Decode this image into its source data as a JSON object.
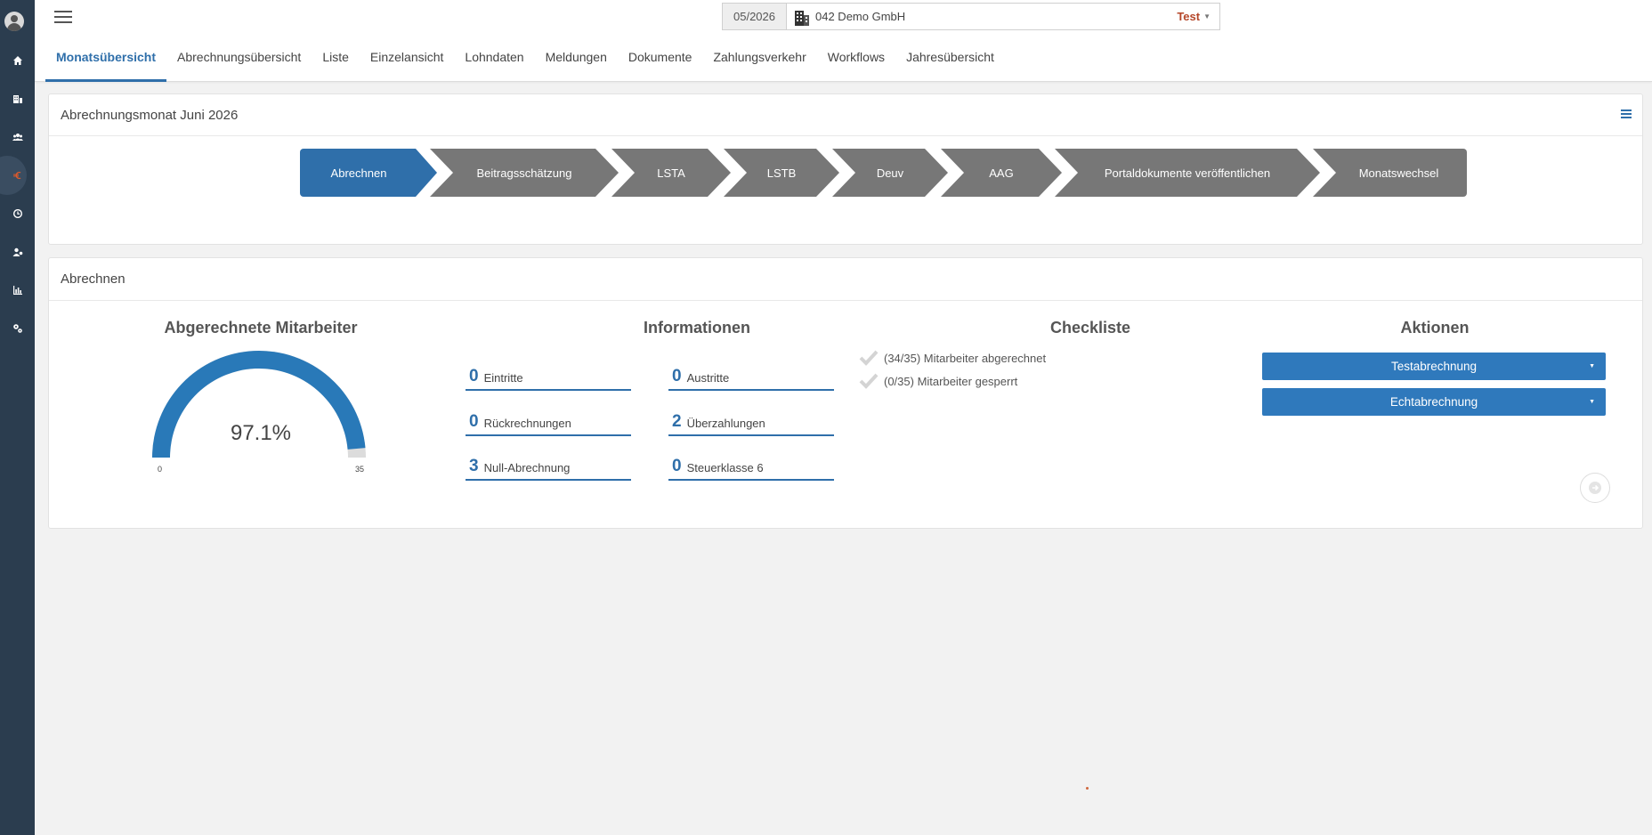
{
  "header": {
    "month": "05/2026",
    "company": "042 Demo GmbH",
    "environment": "Test"
  },
  "tabs": [
    {
      "label": "Monatsübersicht",
      "active": true
    },
    {
      "label": "Abrechnungsübersicht"
    },
    {
      "label": "Liste"
    },
    {
      "label": "Einzelansicht"
    },
    {
      "label": "Lohndaten"
    },
    {
      "label": "Meldungen"
    },
    {
      "label": "Dokumente"
    },
    {
      "label": "Zahlungsverkehr"
    },
    {
      "label": "Workflows"
    },
    {
      "label": "Jahresübersicht"
    }
  ],
  "sidebar": {
    "items": [
      {
        "icon": "home-icon"
      },
      {
        "icon": "building-icon"
      },
      {
        "icon": "users-icon"
      },
      {
        "icon": "euro-icon",
        "active": true
      },
      {
        "icon": "clock-icon"
      },
      {
        "icon": "user-settings-icon"
      },
      {
        "icon": "chart-icon"
      },
      {
        "icon": "cogs-icon"
      }
    ]
  },
  "process_panel": {
    "title": "Abrechnungsmonat Juni 2026",
    "steps": [
      {
        "label": "Abrechnen",
        "current": true
      },
      {
        "label": "Beitragsschätzung"
      },
      {
        "label": "LSTA"
      },
      {
        "label": "LSTB"
      },
      {
        "label": "Deuv"
      },
      {
        "label": "AAG"
      },
      {
        "label": "Portaldokumente veröffentlichen"
      },
      {
        "label": "Monatswechsel"
      }
    ]
  },
  "abrechnen_panel": {
    "title": "Abrechnen",
    "gauge": {
      "title": "Abgerechnete Mitarbeiter",
      "value_text": "97.1%",
      "min": "0",
      "max": "35",
      "fraction": 0.971
    },
    "informationen": {
      "title": "Informationen",
      "items": [
        {
          "num": "0",
          "label": "Eintritte"
        },
        {
          "num": "0",
          "label": "Austritte"
        },
        {
          "num": "0",
          "label": "Rückrechnungen"
        },
        {
          "num": "2",
          "label": "Überzahlungen"
        },
        {
          "num": "3",
          "label": "Null-Abrechnung"
        },
        {
          "num": "0",
          "label": "Steuerklasse 6"
        }
      ]
    },
    "checkliste": {
      "title": "Checkliste",
      "items": [
        {
          "label": "(34/35) Mitarbeiter abgerechnet"
        },
        {
          "label": "(0/35) Mitarbeiter gesperrt"
        }
      ]
    },
    "aktionen": {
      "title": "Aktionen",
      "buttons": [
        {
          "label": "Testabrechnung"
        },
        {
          "label": "Echtabrechnung"
        }
      ]
    }
  },
  "colors": {
    "accent": "#2f6faa",
    "sidebar": "#2b3d4f",
    "step_inactive": "#777777",
    "env": "#b5472a"
  }
}
